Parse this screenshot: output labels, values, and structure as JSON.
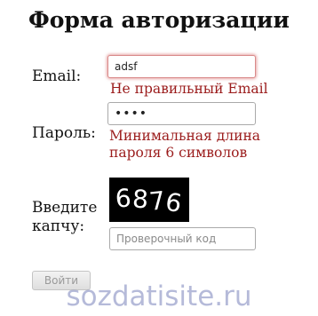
{
  "form": {
    "title": "Форма авторизации",
    "email_label": "Email:",
    "email_value": "adsf",
    "email_error": "Не правильный Email",
    "password_label": "Пароль:",
    "password_value": "abcd",
    "password_error": "Минимальная длина пароля 6 символов",
    "captcha_label": "Введите капчу:",
    "captcha_digits": [
      "6",
      "8",
      "7",
      "6"
    ],
    "captcha_placeholder": "Проверочный код",
    "submit_label": "Войти",
    "submit_enabled": false
  },
  "watermark": "sozdatisite.ru",
  "colors": {
    "error_text": "#9b1c1c",
    "invalid_field_glow": "#d25a5a",
    "captcha_background": "#000000",
    "watermark": "#7882b9"
  }
}
